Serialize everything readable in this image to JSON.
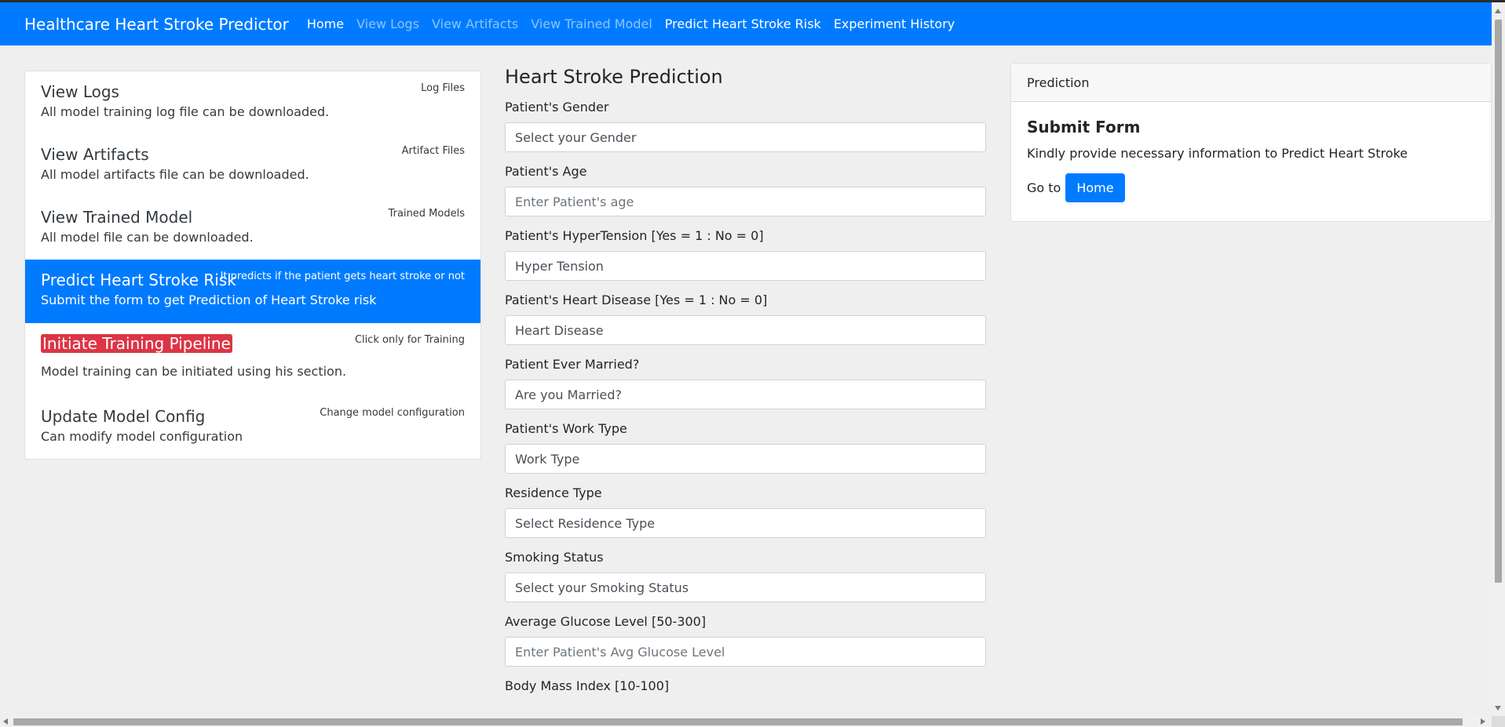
{
  "navbar": {
    "brand": "Healthcare Heart Stroke Predictor",
    "links": [
      {
        "label": "Home"
      },
      {
        "label": "View Logs"
      },
      {
        "label": "View Artifacts"
      },
      {
        "label": "View Trained Model"
      },
      {
        "label": "Predict Heart Stroke Risk"
      },
      {
        "label": "Experiment History"
      }
    ]
  },
  "sidebar": {
    "items": [
      {
        "title": "View Logs",
        "small": "Log Files",
        "desc": "All model training log file can be downloaded."
      },
      {
        "title": "View Artifacts",
        "small": "Artifact Files",
        "desc": "All model artifacts file can be downloaded."
      },
      {
        "title": "View Trained Model",
        "small": "Trained Models",
        "desc": "All model file can be downloaded."
      },
      {
        "title": "Predict Heart Stroke Risk",
        "small": "It predicts if the patient gets heart stroke or not",
        "desc": "Submit the form to get Prediction of Heart Stroke risk"
      },
      {
        "title": "Initiate Training Pipeline",
        "small": "Click only for Training",
        "desc": "Model training can be initiated using his section."
      },
      {
        "title": "Update Model Config",
        "small": "Change model configuration",
        "desc": "Can modify model configuration"
      }
    ]
  },
  "form": {
    "title": "Heart Stroke Prediction",
    "fields": [
      {
        "label": "Patient's Gender",
        "placeholder": "Select your Gender"
      },
      {
        "label": "Patient's Age",
        "placeholder": "Enter Patient's age"
      },
      {
        "label": "Patient's HyperTension [Yes = 1 : No = 0]",
        "placeholder": "Hyper Tension"
      },
      {
        "label": "Patient's Heart Disease [Yes = 1 : No = 0]",
        "placeholder": "Heart Disease"
      },
      {
        "label": "Patient Ever Married?",
        "placeholder": "Are you Married?"
      },
      {
        "label": "Patient's Work Type",
        "placeholder": "Work Type"
      },
      {
        "label": "Residence Type",
        "placeholder": "Select Residence Type"
      },
      {
        "label": "Smoking Status",
        "placeholder": "Select your Smoking Status"
      },
      {
        "label": "Average Glucose Level [50-300]",
        "placeholder": "Enter Patient's Avg Glucose Level"
      },
      {
        "label": "Body Mass Index [10-100]"
      }
    ]
  },
  "card": {
    "header": "Prediction",
    "title": "Submit Form",
    "text": "Kindly provide necessary information to Predict Heart Stroke",
    "goto_label": "Go to",
    "home_button": "Home"
  },
  "colors": {
    "primary": "#007bff",
    "danger": "#dc3545",
    "background": "#efefef"
  }
}
